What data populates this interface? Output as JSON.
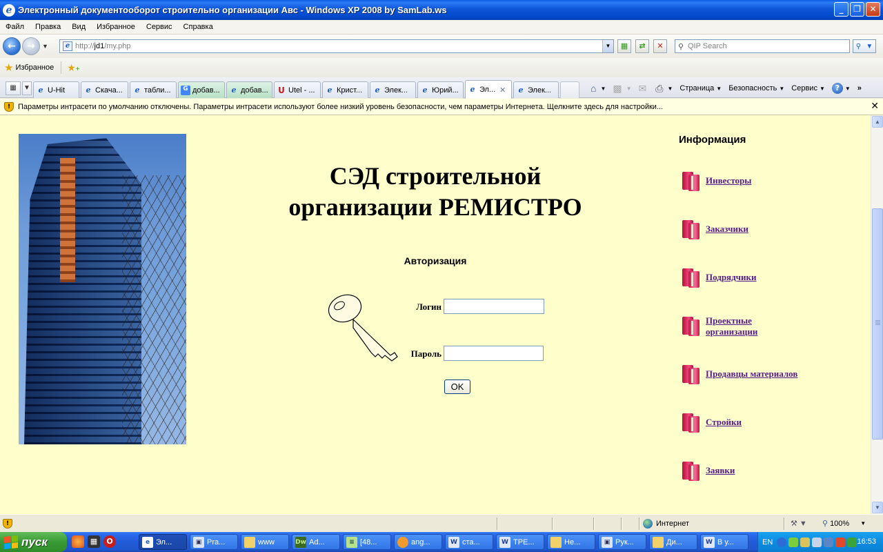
{
  "window": {
    "title": "Электронный документооборот строительно организации Авс - Windows XP 2008 by SamLab.ws",
    "buttons": [
      "_",
      "❐",
      "✕"
    ]
  },
  "menu": [
    "Файл",
    "Правка",
    "Вид",
    "Избранное",
    "Сервис",
    "Справка"
  ],
  "address": {
    "url_prefix": "http://",
    "url_host": "jd1",
    "url_path": "/my.php"
  },
  "search": {
    "placeholder": "QIP Search"
  },
  "favorites": {
    "label": "Избранное"
  },
  "tabs": [
    {
      "label": "U-Hit",
      "icon": "ie",
      "style": "normal"
    },
    {
      "label": "Скача...",
      "icon": "ie",
      "style": "normal"
    },
    {
      "label": "табли...",
      "icon": "ie",
      "style": "normal"
    },
    {
      "label": "добав...",
      "icon": "google",
      "style": "green"
    },
    {
      "label": "добав...",
      "icon": "ie",
      "style": "green"
    },
    {
      "label": "Utel - ...",
      "icon": "utel",
      "style": "normal"
    },
    {
      "label": "Крист...",
      "icon": "ie",
      "style": "normal"
    },
    {
      "label": "Элек...",
      "icon": "ie",
      "style": "normal"
    },
    {
      "label": "Юрий...",
      "icon": "ie",
      "style": "normal"
    },
    {
      "label": "Эл...",
      "icon": "ie",
      "style": "active"
    },
    {
      "label": "Элек...",
      "icon": "ie",
      "style": "normal"
    }
  ],
  "commandbar": {
    "page": "Страница",
    "safety": "Безопасность",
    "tools": "Сервис"
  },
  "infobar": {
    "text": "Параметры интрасети по умолчанию отключены. Параметры интрасети используют более низкий уровень безопасности, чем параметры Интернета. Щелкните здесь для настройки..."
  },
  "page": {
    "heading_line1": "СЭД строительной",
    "heading_line2": "организации РЕМИСТРО",
    "auth_title": "Авторизация",
    "login_label": "Логин",
    "password_label": "Пароль",
    "login_value": "",
    "password_value": "",
    "ok_label": "OK",
    "info_title": "Информация",
    "nav": [
      {
        "line1": "Инвесторы",
        "line2": ""
      },
      {
        "line1": "Заказчики",
        "line2": ""
      },
      {
        "line1": "Подрядчики",
        "line2": ""
      },
      {
        "line1": "Проектные",
        "line2": "организации"
      },
      {
        "line1": "Продавцы материалов",
        "line2": ""
      },
      {
        "line1": "Стройки",
        "line2": ""
      },
      {
        "line1": "Заявки",
        "line2": ""
      }
    ]
  },
  "status": {
    "zone": "Интернет",
    "zoom": "100%"
  },
  "taskbar": {
    "start": "пуск",
    "buttons": [
      {
        "label": "Эл...",
        "icon": "ie"
      },
      {
        "label": "Pra...",
        "icon": "img"
      },
      {
        "label": "www",
        "icon": "folder"
      },
      {
        "label": "Ad...",
        "icon": "dw"
      },
      {
        "label": "[48...",
        "icon": "note"
      },
      {
        "label": "ang...",
        "icon": "ff"
      },
      {
        "label": "ста...",
        "icon": "word"
      },
      {
        "label": "TPE...",
        "icon": "word"
      },
      {
        "label": "Не...",
        "icon": "folder"
      },
      {
        "label": "Рук...",
        "icon": "img"
      },
      {
        "label": "Ди...",
        "icon": "folder"
      },
      {
        "label": "В у...",
        "icon": "word"
      }
    ],
    "lang": "EN",
    "clock": "16:53"
  }
}
